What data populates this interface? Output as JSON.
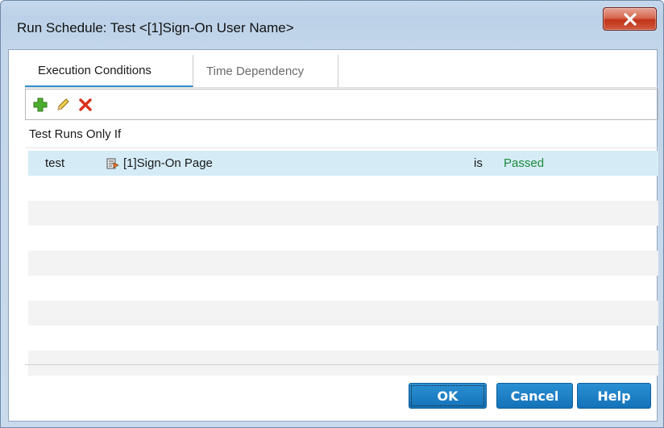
{
  "window": {
    "title": "Run Schedule: Test <[1]Sign-On User Name>",
    "close_label": "X"
  },
  "tabs": [
    {
      "label": "Execution Conditions",
      "active": true
    },
    {
      "label": "Time Dependency",
      "active": false
    }
  ],
  "toolbar": {
    "icons": [
      "add-icon",
      "edit-icon",
      "delete-icon"
    ]
  },
  "section": {
    "label": "Test Runs Only If"
  },
  "conditions": [
    {
      "test": "test",
      "page": "[1]Sign-On Page",
      "operator": "is",
      "status": "Passed"
    }
  ],
  "buttons": {
    "ok": "OK",
    "cancel": "Cancel",
    "help": "Help"
  },
  "colors": {
    "accent": "#1a7cc4",
    "selected_row": "#d5ecf7",
    "status_passed": "#1e8a3a",
    "close_red": "#c2331a"
  }
}
